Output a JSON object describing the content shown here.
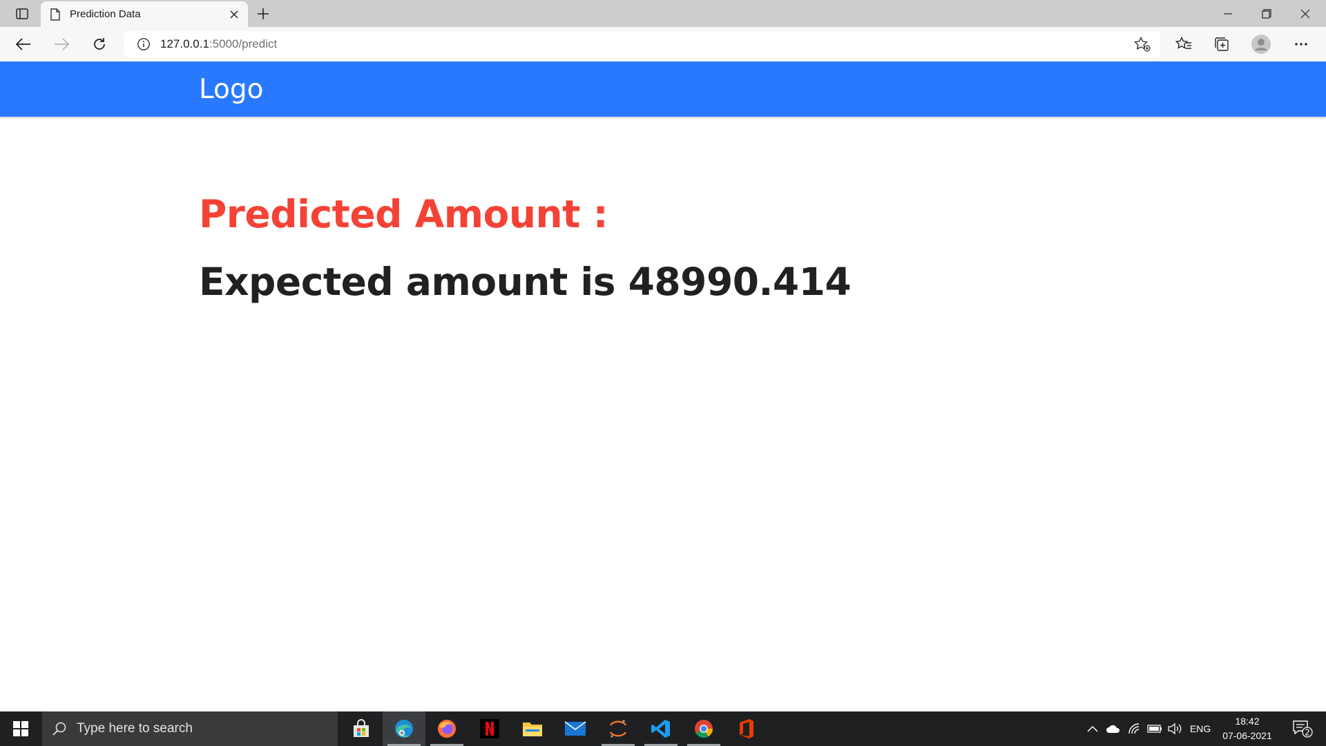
{
  "browser": {
    "tab_title": "Prediction Data",
    "url_host": "127.0.0.1",
    "url_path": ":5000/predict"
  },
  "page": {
    "logo": "Logo",
    "heading": "Predicted Amount :",
    "result": "Expected amount is 48990.414",
    "nav_color": "#2979ff",
    "heading_color": "#f44336"
  },
  "taskbar": {
    "search_placeholder": "Type here to search",
    "apps": [
      "store-icon",
      "edge-icon",
      "firefox-icon",
      "netflix-icon",
      "file-explorer-icon",
      "mail-icon",
      "jupyter-icon",
      "vscode-icon",
      "chrome-icon",
      "office-icon"
    ],
    "language": "ENG",
    "time": "18:42",
    "date": "07-06-2021",
    "notification_count": "2"
  }
}
